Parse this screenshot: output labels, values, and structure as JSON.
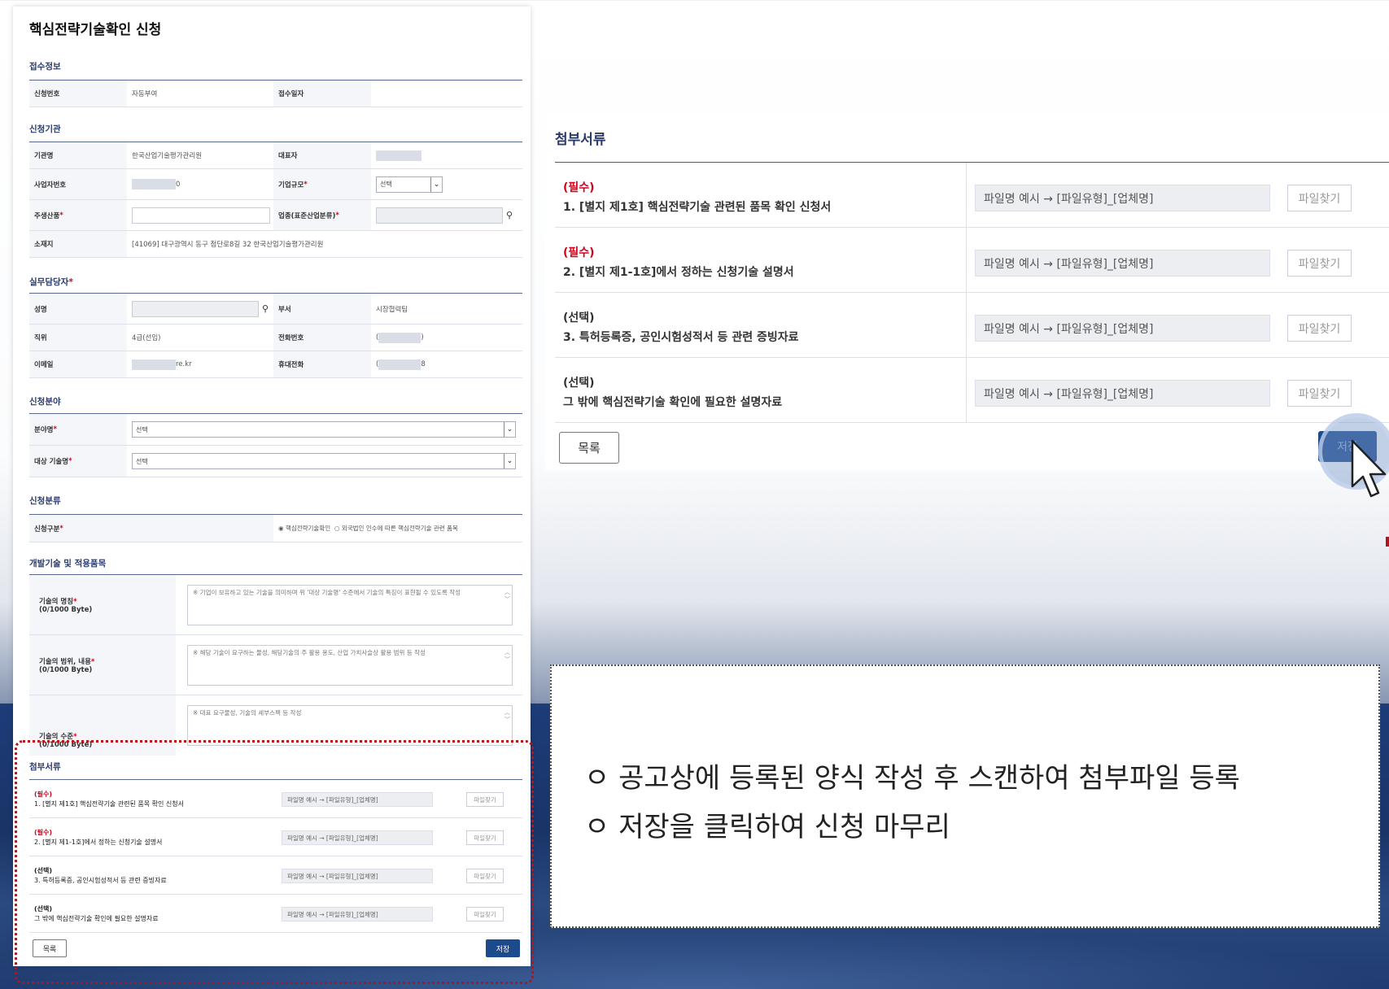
{
  "form": {
    "title": "핵심전략기술확인 신청",
    "reception": {
      "section": "접수정보",
      "app_no_label": "신청번호",
      "app_no_value": "자동부여",
      "date_label": "접수일자",
      "date_value": ""
    },
    "applicant": {
      "section": "신청기관",
      "org_label": "기관명",
      "org_value": "한국산업기술평가관리원",
      "ceo_label": "대표자",
      "bizno_label": "사업자번호",
      "bizno_suffix": "0",
      "size_label": "기업규모",
      "size_value": "선택",
      "product_label": "주생산품",
      "industry_label": "업종(표준산업분류)",
      "address_label": "소재지",
      "address_value": "[41069] 대구광역시 동구 첨단로8길 32 한국산업기술평가관리원"
    },
    "manager": {
      "section": "실무담당자",
      "name_label": "성명",
      "dept_label": "부서",
      "dept_value": "시장협력팀",
      "position_label": "직위",
      "position_value": "4급(선임)",
      "phone_label": "전화번호",
      "phone_prefix": "(",
      "phone_suffix": ")",
      "email_label": "이메일",
      "email_suffix": "re.kr",
      "mobile_label": "휴대전화",
      "mobile_prefix": "(",
      "mobile_suffix": "8"
    },
    "field": {
      "section": "신청분야",
      "field_label": "분야명",
      "field_value": "선택",
      "tech_label": "대상 기술명",
      "tech_value": "선택"
    },
    "category": {
      "section": "신청분류",
      "type_label": "신청구분",
      "option1": "핵심전략기술확인",
      "option2": "외국법인 인수에 따른 핵심전략기술 관련 품목"
    },
    "devtech": {
      "section": "개발기술 및 적용품목",
      "name_label": "기술의 명칭",
      "name_bytes": "(0/1000 Byte)",
      "name_placeholder": "※ 기업이 보유하고 있는 기술을 의미하며 위 '대상 기술명' 수준에서 기술의 특징이 표현될 수 있도록 작성",
      "scope_label": "기술의 범위, 내용",
      "scope_bytes": "(0/1000 Byte)",
      "scope_placeholder": "※ 해당 기술이 요구하는 물성, 해당기술의 주 활용 용도, 산업 가치사슬상 활용 범위 등 작성",
      "level_label": "기술의 수준",
      "level_bytes": "(0/1000 Byte)",
      "level_placeholder": "※ 대표 요구물성, 기술의 세부스펙 등 작성"
    },
    "attachments": {
      "section": "첨부서류",
      "items": [
        {
          "tag": "(필수)",
          "name": "1. [별지 제1호] 핵심전략기술 관련된 품목 확인 신청서",
          "file": "파일명 예시 → [파일유형]_[업체명]",
          "button": "파일찾기"
        },
        {
          "tag": "(필수)",
          "name": "2. [별지 제1-1호]에서 정하는 신청기술 설명서",
          "file": "파일명 예시 → [파일유형]_[업체명]",
          "button": "파일찾기"
        },
        {
          "tag": "(선택)",
          "name": "3. 특허등록증, 공인시험성적서 등 관련 증빙자료",
          "file": "파일명 예시 → [파일유형]_[업체명]",
          "button": "파일찾기"
        },
        {
          "tag": "(선택)",
          "name": "그 밖에 핵심전략기술 확인에 필요한 설명자료",
          "file": "파일명 예시 → [파일유형]_[업체명]",
          "button": "파일찾기"
        }
      ],
      "list_button": "목록",
      "save_button": "저장"
    }
  },
  "note": {
    "line1": "ㅇ 공고상에 등록된 양식 작성 후 스캔하여 첨부파일 등록",
    "line2": "ㅇ 저장을 클릭하여 신청 마무리"
  },
  "colors": {
    "accent_blue": "#1c4a8c",
    "required_red": "#d0021b",
    "highlight_red": "#b0151b",
    "section_title": "#2a3a6b"
  }
}
